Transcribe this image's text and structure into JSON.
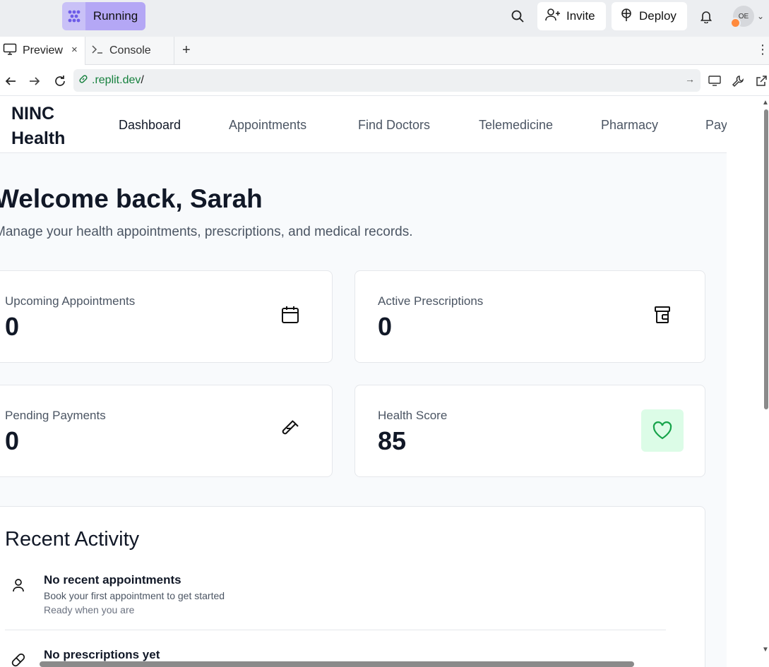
{
  "topbar": {
    "run_label": "Running",
    "invite_label": "Invite",
    "deploy_label": "Deploy",
    "avatar_initials": "OE"
  },
  "tabs": [
    {
      "label": "Preview",
      "icon": "monitor-icon",
      "close": "×"
    },
    {
      "label": "Console",
      "icon": "terminal-icon"
    }
  ],
  "tab_add": "+",
  "tab_more": "⋮",
  "address": {
    "url": ".replit.dev",
    "slash": "/"
  },
  "site": {
    "brand": "NINC Health",
    "nav": [
      "Dashboard",
      "Appointments",
      "Find Doctors",
      "Telemedicine",
      "Pharmacy",
      "Payments"
    ],
    "active_nav": "Dashboard"
  },
  "dashboard": {
    "welcome": "Welcome back, Sarah",
    "subtitle": "Manage your health appointments, prescriptions, and medical records.",
    "stats": [
      {
        "label": "Upcoming Appointments",
        "value": "0",
        "icon": "calendar-icon"
      },
      {
        "label": "Active Prescriptions",
        "value": "0",
        "icon": "pill-bottle-icon"
      },
      {
        "label": "Pending Payments",
        "value": "0",
        "icon": "test-tube-icon"
      },
      {
        "label": "Health Score",
        "value": "85",
        "icon": "heart-icon"
      }
    ],
    "accent_green": "#16a34a",
    "recent_title": "Recent Activity",
    "activities": [
      {
        "title": "No recent appointments",
        "subtitle": "Book your first appointment to get started",
        "meta": "Ready when you are",
        "icon": "user-icon"
      },
      {
        "title": "No prescriptions yet",
        "icon": "pill-icon"
      }
    ]
  }
}
